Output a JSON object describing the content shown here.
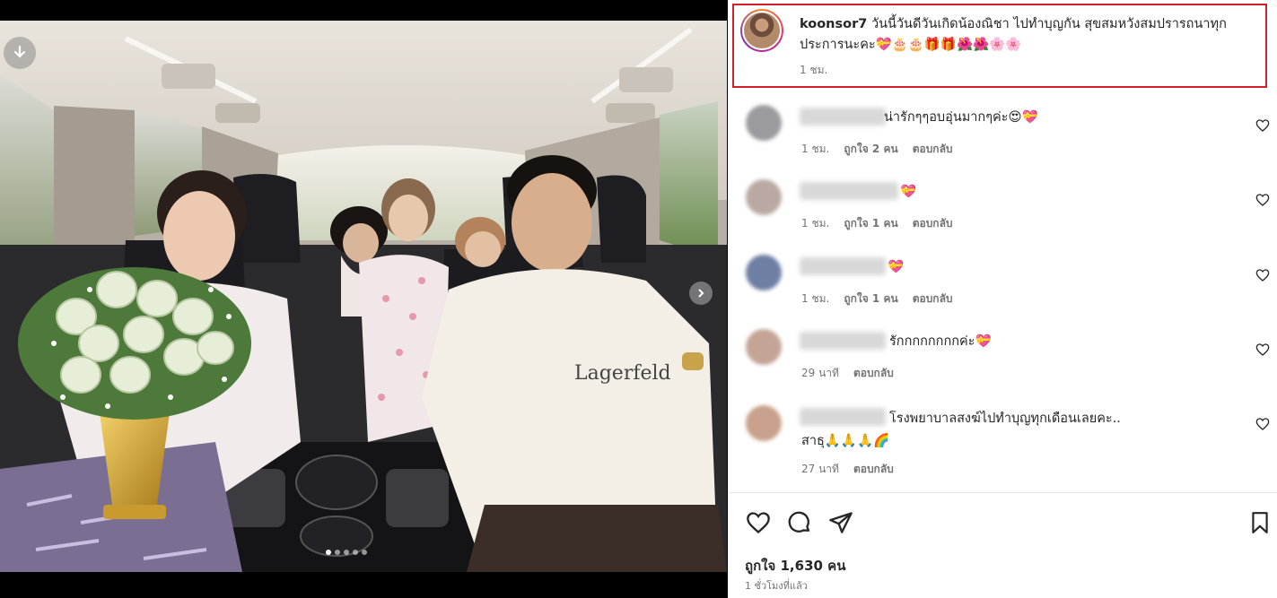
{
  "post": {
    "username": "koonsor7",
    "caption": "วันนี้วันดีวันเกิดน้องณิชา ไปทำบุญกัน สุขสมหวังสมปรารถนาทุกประการนะคะ💝🎂🎂🎁🎁🌺🌺🌸🌸",
    "time_ago": "1 ชม."
  },
  "comments": [
    {
      "text": "น่ารักๆๆอบอุ่นมากๆค่ะ😍💝",
      "time": "1 ชม.",
      "likes": "ถูกใจ 2 คน",
      "reply": "ตอบกลับ",
      "icon": "heart-outline-icon"
    },
    {
      "text": "💝",
      "time": "1 ชม.",
      "likes": "ถูกใจ 1 คน",
      "reply": "ตอบกลับ",
      "icon": "heart-outline-icon"
    },
    {
      "text": "💝",
      "time": "1 ชม.",
      "likes": "ถูกใจ 1 คน",
      "reply": "ตอบกลับ",
      "icon": "heart-outline-icon"
    },
    {
      "text": "รักกกกกกกกค่ะ💝",
      "time": "29 นาที",
      "reply": "ตอบกลับ",
      "icon": "heart-outline-icon"
    },
    {
      "text": "โรงพยาบาลสงฆ์ไปทำบุญทุกเดือนเลยคะ.. สาธุ🙏🙏🙏🌈",
      "time": "27 นาที",
      "reply": "ตอบกลับ",
      "icon": "heart-outline-icon"
    }
  ],
  "actions": {
    "icons": [
      "heart-outline-icon",
      "comment-bubble-icon",
      "share-paper-plane-icon",
      "bookmark-icon"
    ]
  },
  "likes": "ถูกใจ 1,630 คน",
  "posted": "1 ชั่วโมงที่แล้ว",
  "carousel": {
    "count": 5,
    "active_index": 0
  },
  "colors": {
    "highlight_border": "#d0202a",
    "text": "#262626",
    "muted": "#737373"
  }
}
